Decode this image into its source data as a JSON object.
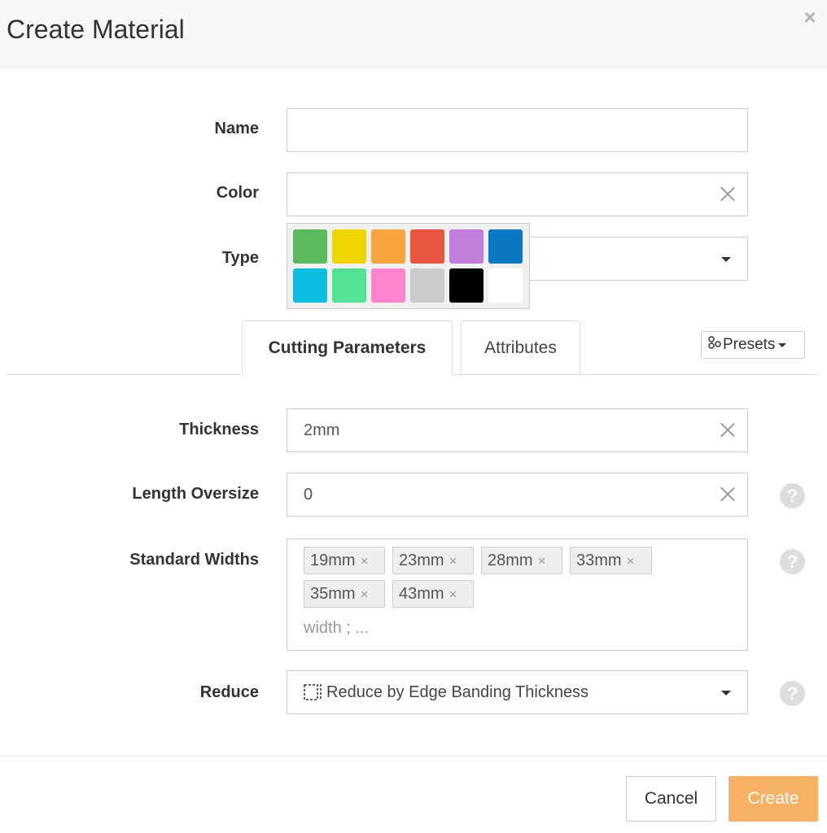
{
  "dialog": {
    "title": "Create Material",
    "close_label": "×"
  },
  "form": {
    "name_label": "Name",
    "name_value": "",
    "color_label": "Color",
    "color_value": "",
    "type_label": "Type",
    "type_value": ""
  },
  "palette": {
    "colors": [
      "#5cb85c",
      "#f0d500",
      "#f8a540",
      "#e9553f",
      "#c07ddb",
      "#0a78c3",
      "#0bbfe0",
      "#53e394",
      "#ff84cd",
      "#cccccc",
      "#000000",
      "#ffffff"
    ]
  },
  "tabs": {
    "cutting": "Cutting Parameters",
    "attributes": "Attributes",
    "active": "cutting"
  },
  "presets": {
    "label": "Presets"
  },
  "params": {
    "thickness_label": "Thickness",
    "thickness_value": "2mm",
    "length_oversize_label": "Length Oversize",
    "length_oversize_value": "0",
    "standard_widths_label": "Standard Widths",
    "standard_widths": [
      "19mm",
      "23mm",
      "28mm",
      "33mm",
      "35mm",
      "43mm"
    ],
    "standard_widths_placeholder": "width ; ...",
    "reduce_label": "Reduce",
    "reduce_value": "Reduce by Edge Banding Thickness"
  },
  "help": {
    "glyph": "?"
  },
  "footer": {
    "cancel_label": "Cancel",
    "create_label": "Create"
  }
}
